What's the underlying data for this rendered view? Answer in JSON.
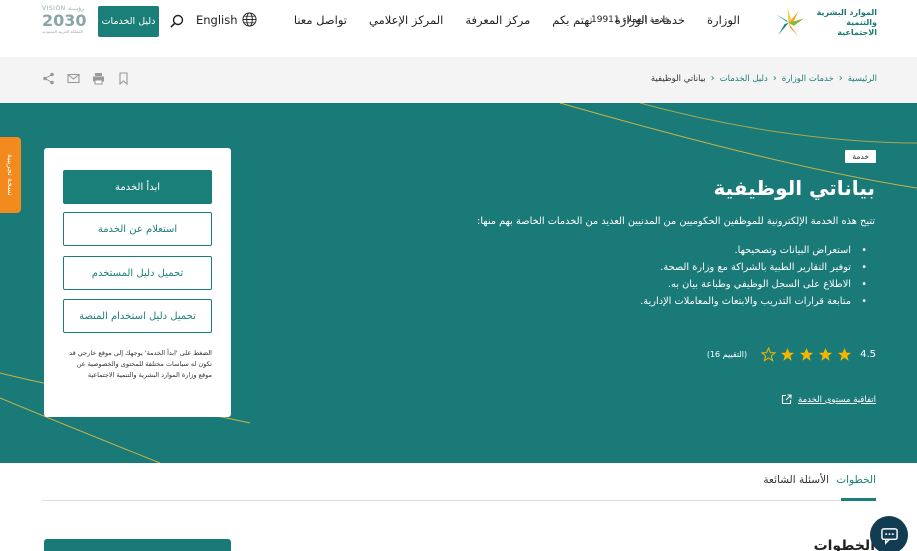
{
  "header": {
    "logo_line1": "الموارد البشرية",
    "logo_line2": "والتنمية الاجتماعية",
    "nav": [
      "الوزارة",
      "خدمات الوزارة",
      "نهتم بكم",
      "مركز المعرفة",
      "المركز الإعلامي",
      "تواصل معنا"
    ],
    "hotline": "خدمة العملاء 19911",
    "language": "English",
    "services_guide": "دليل الخدمات",
    "vision_top": "رؤيـــة",
    "vision_number": "2030",
    "vision_word": "VISION",
    "vision_sub": "المملكة العربية السعودية"
  },
  "breadcrumb": [
    "الرئيسية",
    "خدمات الوزارة",
    "دليل الخدمات",
    "بياناتي الوظيفية"
  ],
  "service": {
    "badge": "خدمة",
    "title": "بياناتي الوظيفية",
    "intro": "تتيح هذه الخدمة الإلكترونية للموظفين الحكوميين من المدنيين العديد من الخدمات الخاصة بهم منها:",
    "features": [
      "استعراض البيانات وتصحيحها.",
      "توفير التقارير الطبية بالشراكة مع وزارة الصحة.",
      "الاطلاع على السجل الوظيفي وطباعة بيان به.",
      "متابعة قرارات التدريب والابتعاث والمعاملات الإدارية."
    ],
    "rating_value": "4.5",
    "rating": 4.5,
    "rating_count": "(التقييم 16)",
    "sla_link": "اتفاقية مستوى الخدمة"
  },
  "card": {
    "start": "ابدأ الخدمة",
    "inquiry": "استعلام عن الخدمة",
    "user_guide": "تحميل دليل المستخدم",
    "platform_guide": "تحميل دليل استخدام المنصة",
    "note": "الضغط على 'ابدأ الخدمة' يوجهك إلى موقع خارجي قد تكون له سياسات مختلفة للمحتوى والخصوصية عن موقع وزارة الموارد البشرية والتنمية الاجتماعية"
  },
  "side_tab": "نسخة تجريبية",
  "tabs": [
    "الخطوات",
    "الأسئلة الشائعة"
  ],
  "steps_heading": "الخطوات",
  "colors": {
    "primary": "#1b7f79",
    "hero": "#1a7a78",
    "accent": "#f28a1e",
    "chat": "#123c52"
  }
}
